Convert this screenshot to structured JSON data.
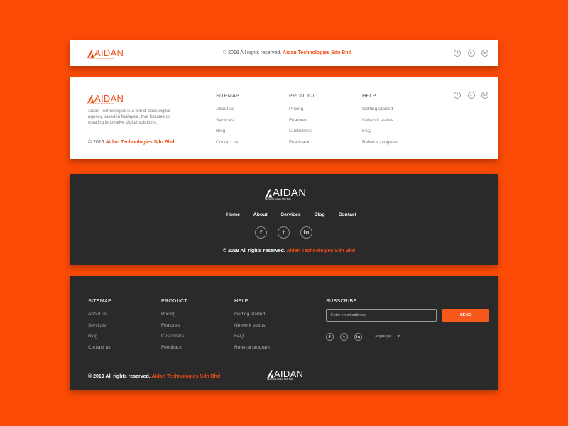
{
  "brand": {
    "logo_word": "AIDAN",
    "logo_tagline": "TECHNOLOGIES SDN BHD",
    "accent_color": "#f04e15",
    "background_color": "#fa4a06"
  },
  "social_icons": [
    "facebook-icon",
    "twitter-icon",
    "linkedin-icon"
  ],
  "social_glyphs": [
    "f",
    "t",
    "in"
  ],
  "footer1": {
    "copyright_prefix": "© 2019 All rights reserved.",
    "company": "Aidan Technologies Sdn Bhd"
  },
  "footer2": {
    "about": "Aidan Technologies is a world-class digital agency based in Malaysia, that focuses on creating innovative digital solutions.",
    "copyright_prefix": "© 2019",
    "company": "Aidan Technologies Sdn Bhd",
    "columns": [
      {
        "title": "SITEMAP",
        "items": [
          "About us",
          "Services",
          "Blog",
          "Contact us"
        ]
      },
      {
        "title": "PRODUCT",
        "items": [
          "Pricing",
          "Features",
          "Customers",
          "Feedback"
        ]
      },
      {
        "title": "HELP",
        "items": [
          "Getting started",
          "Network status",
          "FAQ",
          "Referral program"
        ]
      }
    ]
  },
  "footer3": {
    "nav": [
      "Home",
      "About",
      "Services",
      "Blog",
      "Contact"
    ],
    "copyright_prefix": "© 2019 All rights reserved.",
    "company": "Aidan Technologies Sdn Bhd"
  },
  "footer4": {
    "columns": [
      {
        "title": "SITEMAP",
        "items": [
          "About us",
          "Services",
          "Blog",
          "Contact us"
        ]
      },
      {
        "title": "PRODUCT",
        "items": [
          "Pricing",
          "Features",
          "Customers",
          "Feedback"
        ]
      },
      {
        "title": "HELP",
        "items": [
          "Getting started",
          "Network status",
          "FAQ",
          "Referral program"
        ]
      }
    ],
    "subscribe_title": "SUBSCRIBE",
    "email_placeholder": "Enter email address",
    "send_label": "SEND",
    "language_label": "Language",
    "copyright_prefix": "© 2019 All rights reserved.",
    "company": "Aidan Technologies Sdn Bhd"
  }
}
